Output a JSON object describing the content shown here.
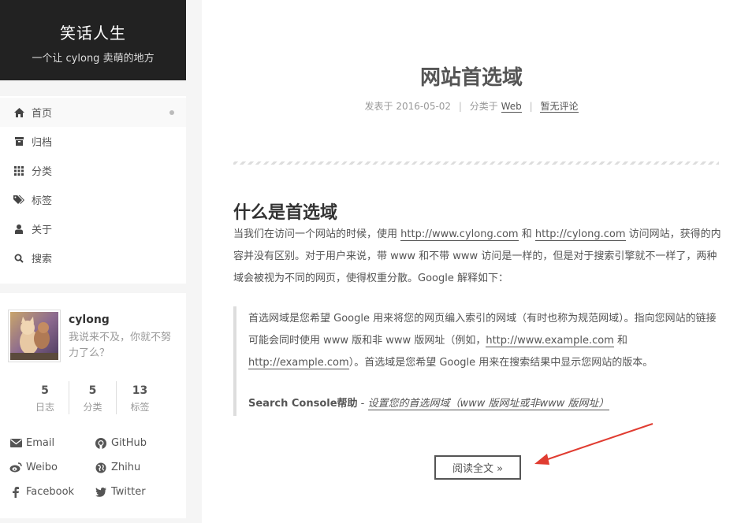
{
  "brand": {
    "title": "笑话人生",
    "subtitle": "一个让 cylong 卖萌的地方"
  },
  "menu": [
    {
      "icon": "home-icon",
      "label": "首页"
    },
    {
      "icon": "archive-icon",
      "label": "归档"
    },
    {
      "icon": "grid-icon",
      "label": "分类"
    },
    {
      "icon": "tags-icon",
      "label": "标签"
    },
    {
      "icon": "user-icon",
      "label": "关于"
    },
    {
      "icon": "search-icon",
      "label": "搜索"
    }
  ],
  "profile": {
    "name": "cylong",
    "description": "我说来不及，你就不努力了么？",
    "stats": [
      {
        "num": "5",
        "label": "日志"
      },
      {
        "num": "5",
        "label": "分类"
      },
      {
        "num": "13",
        "label": "标签"
      }
    ],
    "links": [
      "Email",
      "GitHub",
      "Weibo",
      "Zhihu",
      "Facebook",
      "Twitter"
    ]
  },
  "post": {
    "title": "网站首选域",
    "meta_posted": "发表于 2016-05-02",
    "meta_category_prefix": "分类于",
    "meta_category": "Web",
    "meta_comments": "暂无评论",
    "heading": "什么是首选域",
    "para_1": "当我们在访问一个网站的时候，使用 ",
    "link_1": "http://www.cylong.com",
    "para_2": " 和 ",
    "link_2": "http://cylong.com",
    "para_3": " 访问网站，获得的内容并没有区别。对于用户来说，带 www 和不带 www 访问是一样的，但是对于搜索引擎就不一样了，两种域会被视为不同的网页，使得权重分散。Google 解释如下：",
    "quote_1": "首选网域是您希望 Google 用来将您的网页编入索引的网域（有时也称为规范网域）。指向您网站的链接可能会同时使用 www 版和非 www 版网址（例如，",
    "quote_link_1": "http://www.example.com",
    "quote_2": " 和 ",
    "quote_link_2": "http://example.com",
    "quote_3": "）。首选域是您希望 Google 用来在搜索结果中显示您网站的版本。",
    "cite_source": "Search Console帮助",
    "cite_sep": " - ",
    "cite_title": "设置您的首选网域（www 版网址或非www 版网址）",
    "read_more": "阅读全文 »"
  },
  "colors": {
    "brand_bg": "#222222",
    "arrow": "#e03c31",
    "text": "#555555"
  }
}
